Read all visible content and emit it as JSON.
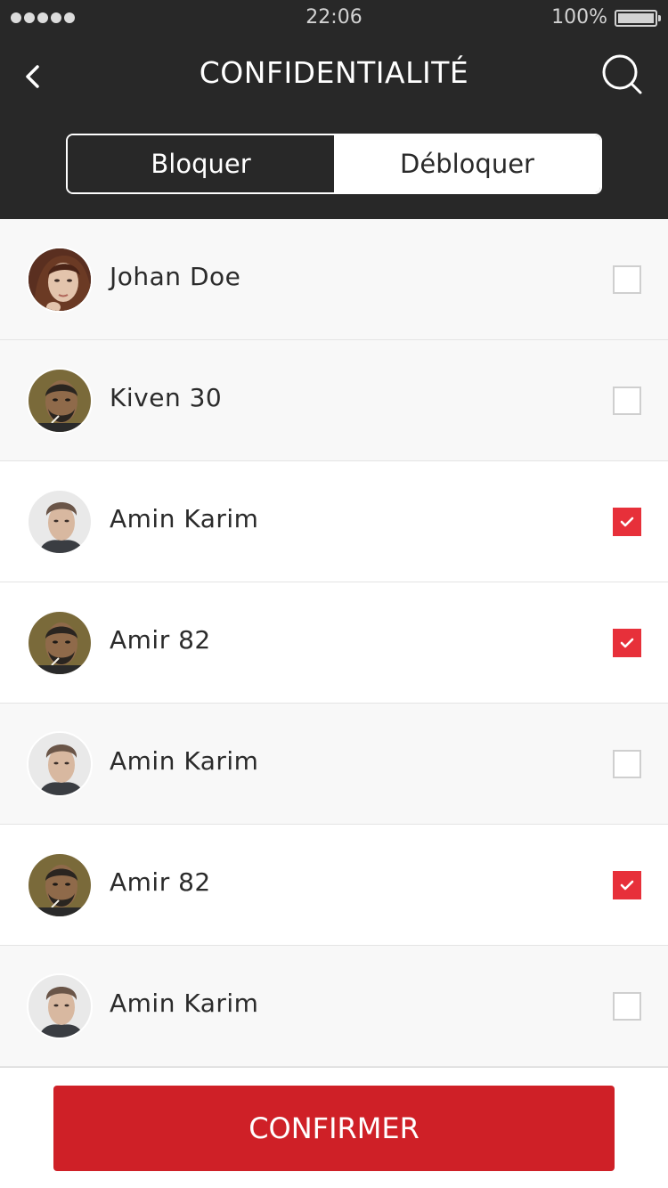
{
  "status_bar": {
    "time": "22:06",
    "battery": "100%",
    "signal_icon": "signal-dots-icon",
    "battery_icon": "battery-icon"
  },
  "header": {
    "title": "CONFIDENTIALITÉ",
    "back_icon": "chevron-left-icon",
    "search_icon": "search-icon",
    "tabs": [
      {
        "label": "Bloquer",
        "active": true
      },
      {
        "label": "Débloquer",
        "active": false
      }
    ]
  },
  "contacts": [
    {
      "name": "Johan Doe",
      "checked": false
    },
    {
      "name": "Kiven 30",
      "checked": false
    },
    {
      "name": "Amin Karim",
      "checked": true
    },
    {
      "name": "Amir 82",
      "checked": true
    },
    {
      "name": "Amin Karim",
      "checked": false
    },
    {
      "name": "Amir 82",
      "checked": true
    },
    {
      "name": "Amin Karim",
      "checked": false
    }
  ],
  "footer": {
    "confirm_label": "CONFIRMER"
  },
  "colors": {
    "header_bg": "#282828",
    "accent_red": "#cf2027",
    "checkbox_red": "#e7303a"
  }
}
